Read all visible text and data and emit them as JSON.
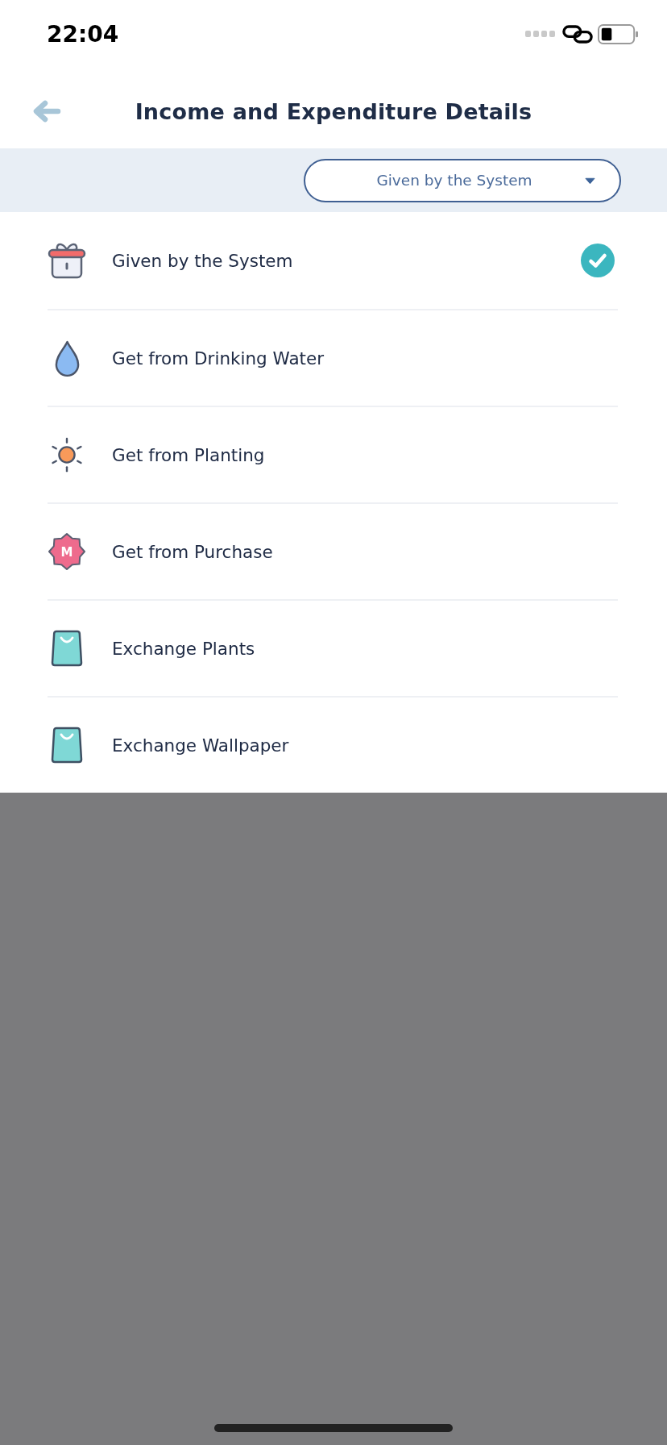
{
  "status_bar": {
    "time": "22:04"
  },
  "header": {
    "title": "Income and Expenditure Details"
  },
  "filter": {
    "value": "Given by the System"
  },
  "options": [
    {
      "label": "Given by the System",
      "kind": "gift",
      "selected": true
    },
    {
      "label": "Get from Drinking Water",
      "kind": "drop",
      "selected": false
    },
    {
      "label": "Get from Planting",
      "kind": "sun",
      "selected": false
    },
    {
      "label": "Get from Purchase",
      "kind": "badge",
      "badge_text": "M",
      "selected": false
    },
    {
      "label": "Exchange Plants",
      "kind": "bag",
      "selected": false
    },
    {
      "label": "Exchange Wallpaper",
      "kind": "bag",
      "selected": false
    }
  ]
}
